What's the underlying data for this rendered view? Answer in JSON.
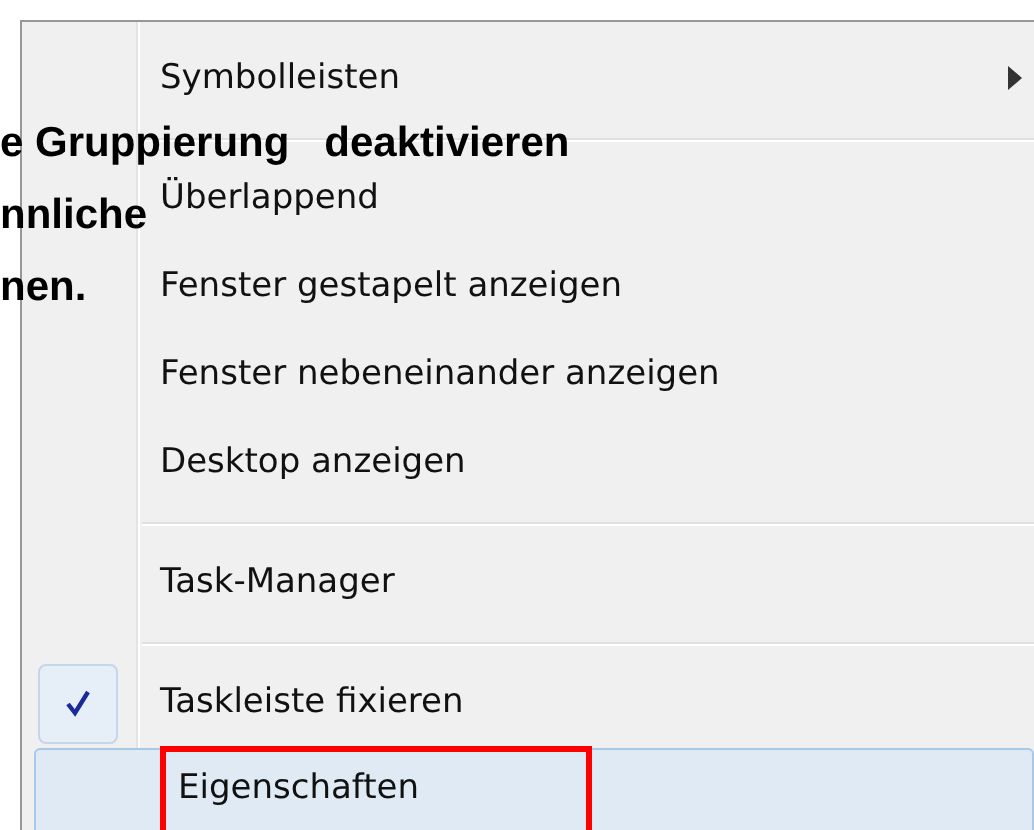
{
  "overlay_text": [
    "e Gruppierung   deaktivieren",
    "nnliche",
    "nen."
  ],
  "menu": {
    "items": [
      {
        "kind": "item",
        "label": "Symbolleisten",
        "submenu": true,
        "checked": false,
        "selected": false,
        "outlined": false
      },
      {
        "kind": "separator"
      },
      {
        "kind": "item",
        "label": "Überlappend",
        "submenu": false,
        "checked": false,
        "selected": false,
        "outlined": false
      },
      {
        "kind": "item",
        "label": "Fenster gestapelt anzeigen",
        "submenu": false,
        "checked": false,
        "selected": false,
        "outlined": false
      },
      {
        "kind": "item",
        "label": "Fenster nebeneinander anzeigen",
        "submenu": false,
        "checked": false,
        "selected": false,
        "outlined": false
      },
      {
        "kind": "item",
        "label": "Desktop anzeigen",
        "submenu": false,
        "checked": false,
        "selected": false,
        "outlined": false
      },
      {
        "kind": "separator"
      },
      {
        "kind": "item",
        "label": "Task-Manager",
        "submenu": false,
        "checked": false,
        "selected": false,
        "outlined": false
      },
      {
        "kind": "separator"
      },
      {
        "kind": "item",
        "label": "Taskleiste fixieren",
        "submenu": false,
        "checked": true,
        "selected": false,
        "outlined": false
      },
      {
        "kind": "item",
        "label": "Eigenschaften",
        "submenu": false,
        "checked": false,
        "selected": true,
        "outlined": true
      }
    ]
  }
}
